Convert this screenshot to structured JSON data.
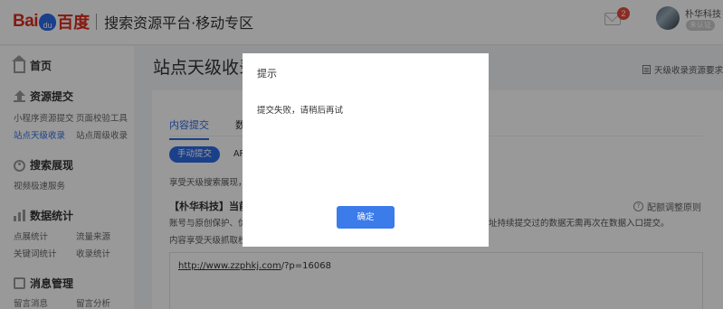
{
  "header": {
    "logo_bai": "Bai",
    "logo_paw": "du",
    "logo_du": "百度",
    "platform_title": "搜索资源平台·移动专区",
    "mail_badge": "2",
    "user_name": "朴华科技",
    "user_tag": "未认证"
  },
  "sidebar": {
    "home": "首页",
    "submit_section": "资源提交",
    "submit_items": [
      "小程序资源提交",
      "页面校验工具",
      "站点天级收录",
      "站点周级收录"
    ],
    "search_section": "搜索展现",
    "search_items": [
      "视频极速服务"
    ],
    "stats_section": "数据统计",
    "stats_items": [
      "点展统计",
      "流量来源",
      "关键词统计",
      "收录统计"
    ],
    "msg_section": "消息管理",
    "msg_items": [
      "留言消息",
      "留言分析"
    ]
  },
  "main": {
    "page_title": "站点天级收录",
    "req_link": "天级收录资源要求",
    "tabs": [
      "内容提交",
      "数"
    ],
    "pill_active": "手动提交",
    "pill_other": "API",
    "desc": "享受天级搜索展现，",
    "quota_title": "【朴华科技】当前天",
    "rule_link": "配额调整原则",
    "notice1": "账号与原创保护、优",
    "notice1b": "址持续提交过的数据无需再次在数据入口提交。",
    "notice2": "内容享受天级抓取校",
    "textarea_url": "http://www.zzphkj.com",
    "textarea_url_tail": "/?p=16068"
  },
  "modal": {
    "title": "提示",
    "message": "提交失败，请稍后再试",
    "confirm": "确定"
  }
}
